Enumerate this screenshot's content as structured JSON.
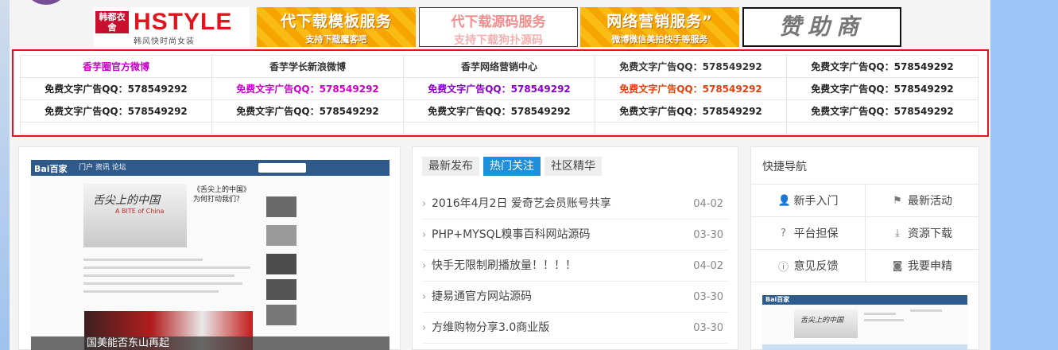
{
  "banner": {
    "hstyle": {
      "logo": "韩都衣舍",
      "brand": "HSTYLE",
      "tagline": "韩风快时尚女装"
    },
    "download_ad": {
      "title": "代下载模板服务",
      "subtitle": "支持下载魔客吧"
    },
    "source_ad": {
      "title": "代下载源码服务",
      "subtitle": "支持下载狗扑源码"
    },
    "marketing_ad": {
      "title": "网络营销服务”",
      "subtitle": "微博微信美拍快手等服务"
    },
    "sponsor": "赞助商"
  },
  "text_ads": {
    "rows": [
      [
        {
          "text": "香芋圈官方微博",
          "color": "#c800c8"
        },
        {
          "text": "香芋学长新浪微博",
          "color": "#333333"
        },
        {
          "text": "香芋网络营销中心",
          "color": "#333333"
        },
        {
          "text": "免费文字广告QQ：578549292",
          "color": "#333333"
        },
        {
          "text": "免费文字广告QQ：578549292",
          "color": "#222222"
        }
      ],
      [
        {
          "text": "免费文字广告QQ：578549292",
          "color": "#222222"
        },
        {
          "text": "免费文字广告QQ：578549292",
          "color": "#c800c8"
        },
        {
          "text": "免费文字广告QQ：578549292",
          "color": "#8b00c8"
        },
        {
          "text": "免费文字广告QQ：578549292",
          "color": "#e0400c"
        },
        {
          "text": "免费文字广告QQ：578549292",
          "color": "#222222"
        }
      ],
      [
        {
          "text": "免费文字广告QQ：578549292",
          "color": "#222222"
        },
        {
          "text": "免费文字广告QQ：578549292",
          "color": "#222222"
        },
        {
          "text": "免费文字广告QQ：578549292",
          "color": "#222222"
        },
        {
          "text": "免费文字广告QQ：578549292",
          "color": "#222222"
        },
        {
          "text": "免费文字广告QQ：578549292",
          "color": "#222222"
        }
      ]
    ]
  },
  "feature": {
    "site_logo": "Bai百家",
    "nav_items": "门户   资讯   论坛",
    "hero_calligraphy": "舌尖上的中国",
    "hero_subtitle": "A BITE of China",
    "hero_title": "《舌尖上的中国》为何打动我们？",
    "caption": "国美能否东山再起"
  },
  "news": {
    "tabs": [
      {
        "label": "最新发布",
        "active": false
      },
      {
        "label": "热门关注",
        "active": true
      },
      {
        "label": "社区精华",
        "active": false
      }
    ],
    "items": [
      {
        "title": "2016年4月2日 爱奇艺会员账号共享",
        "date": "04-02"
      },
      {
        "title": "PHP+MYSQL糗事百科网站源码",
        "date": "03-30"
      },
      {
        "title": "快手无限制刷播放量！！！！",
        "date": "04-02"
      },
      {
        "title": "捷易通官方网站源码",
        "date": "03-30"
      },
      {
        "title": "方维购物分享3.0商业版",
        "date": "03-30"
      }
    ]
  },
  "quick_nav": {
    "title": "快捷导航",
    "items": [
      {
        "label": "新手入门",
        "icon": "user-icon"
      },
      {
        "label": "最新活动",
        "icon": "flag-icon"
      },
      {
        "label": "平台担保",
        "icon": "shield-question-icon"
      },
      {
        "label": "资源下载",
        "icon": "download-icon"
      },
      {
        "label": "意见反馈",
        "icon": "info-icon"
      },
      {
        "label": "我要申精",
        "icon": "camera-icon"
      }
    ]
  },
  "mini_feature": {
    "site_logo": "Bai百家",
    "hero_calligraphy": "舌尖上的中国"
  }
}
